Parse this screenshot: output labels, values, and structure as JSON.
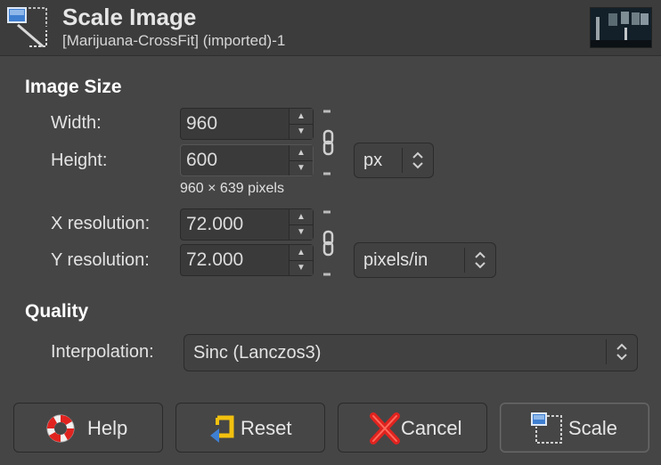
{
  "header": {
    "title": "Scale Image",
    "subtitle": "[Marijuana-CrossFit] (imported)-1"
  },
  "image_size": {
    "section_title": "Image Size",
    "width_label": "Width:",
    "width_value": "960",
    "height_label": "Height:",
    "height_value": "600",
    "size_note": "960 × 639 pixels",
    "size_unit": "px",
    "xres_label": "X resolution:",
    "xres_value": "72.000",
    "yres_label": "Y resolution:",
    "yres_value": "72.000",
    "res_unit": "pixels/in"
  },
  "quality": {
    "section_title": "Quality",
    "interp_label": "Interpolation:",
    "interp_value": "Sinc (Lanczos3)"
  },
  "buttons": {
    "help": "Help",
    "reset": "Reset",
    "cancel": "Cancel",
    "scale": "Scale"
  },
  "icons": {
    "header": "scale-image-icon",
    "help": "lifebuoy-icon",
    "reset": "reset-icon",
    "cancel": "x-cancel-icon",
    "scale": "scale-image-icon"
  },
  "colors": {
    "background": "#454545",
    "accent_blue": "#3f7fd1",
    "cancel_red": "#e0231f",
    "reset_yellow": "#f2c10f"
  }
}
